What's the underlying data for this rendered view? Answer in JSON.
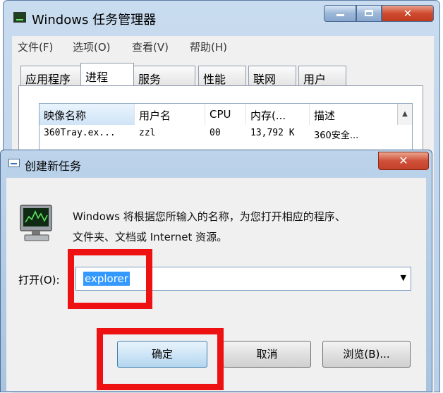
{
  "taskmanager": {
    "title": "Windows 任务管理器",
    "menus": [
      "文件(F)",
      "选项(O)",
      "查看(V)",
      "帮助(H)"
    ],
    "tabs": [
      "应用程序",
      "进程",
      "服务",
      "性能",
      "联网",
      "用户"
    ],
    "active_tab": "进程",
    "columns": [
      "映像名称",
      "用户名",
      "CPU",
      "内存(...",
      "描述"
    ],
    "rows": [
      {
        "image": "360Tray.ex...",
        "user": "zzl",
        "cpu": "00",
        "memory": "13,792 K",
        "description": "360安全..."
      }
    ]
  },
  "dialog": {
    "title": "创建新任务",
    "message_line1": "Windows 将根据您所输入的名称，为您打开相应的程序、",
    "message_line2": "文件夹、文档或 Internet 资源。",
    "open_label": "打开(O):",
    "open_value": "explorer",
    "ok_label": "确定",
    "cancel_label": "取消",
    "browse_label": "浏览(B)..."
  },
  "colors": {
    "highlight": "#ee1111",
    "selection": "#3399ff",
    "title_bar": "#bcd3ea",
    "close_button": "#d0513a"
  },
  "icons": [
    "taskmanager-icon",
    "minimize-icon",
    "maximize-icon",
    "close-icon",
    "run-dialog-icon",
    "computer-icon",
    "dropdown-arrow-icon",
    "scroll-up-icon"
  ]
}
